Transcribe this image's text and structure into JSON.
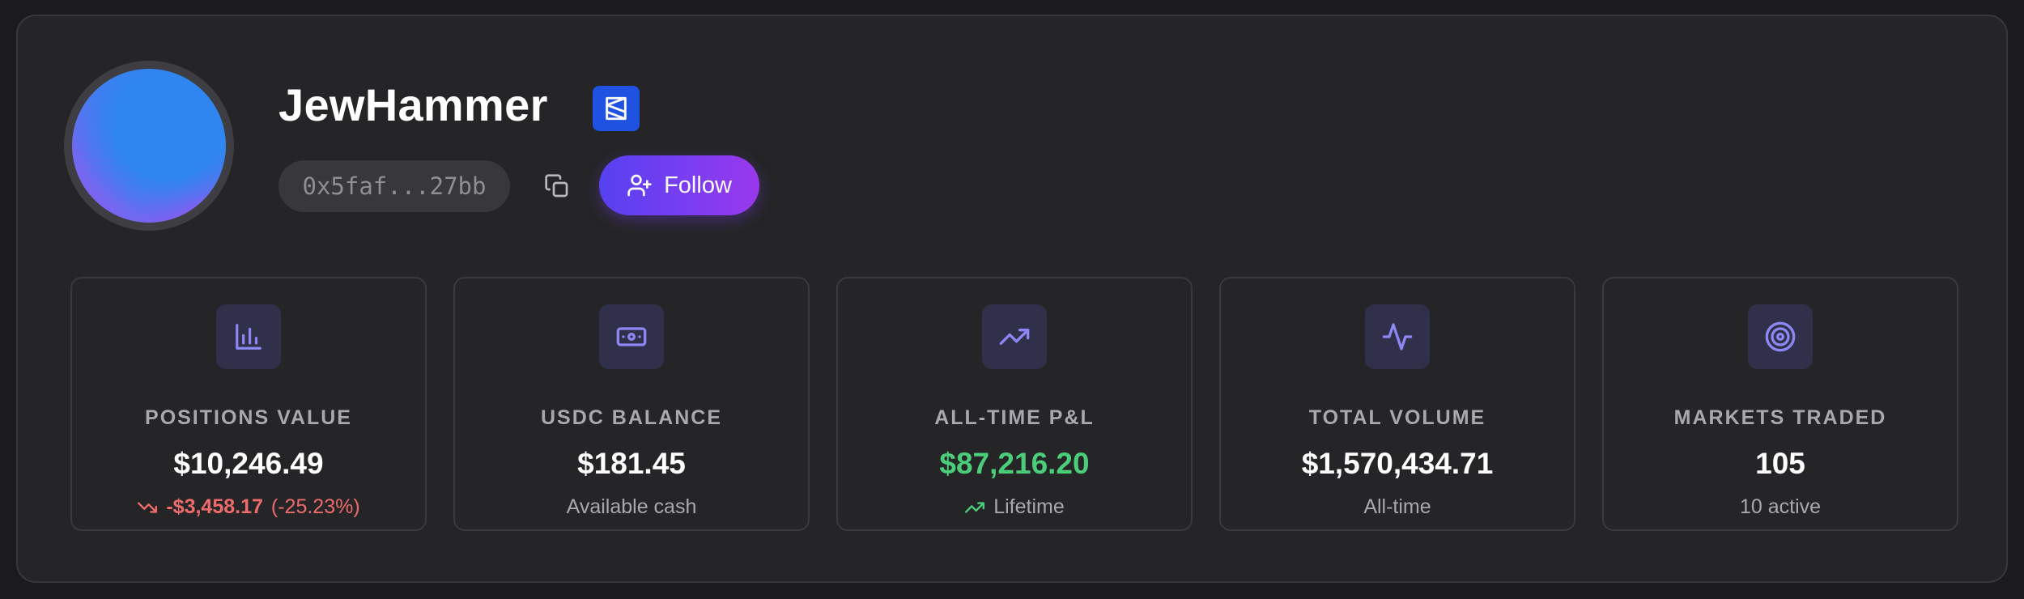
{
  "profile": {
    "username": "JewHammer",
    "address": "0x5faf...27bb",
    "follow_label": "Follow"
  },
  "icons": {
    "badge": "platform-badge-icon",
    "copy": "copy-icon",
    "follow": "user-plus-icon"
  },
  "colors": {
    "accent_start": "#5641f0",
    "accent_end": "#9a38ec",
    "positive": "#4ace7a",
    "negative": "#ee6b6b"
  },
  "stats": [
    {
      "icon": "bar-chart-icon",
      "label": "POSITIONS VALUE",
      "value": "$10,246.49",
      "change_amount": "-$3,458.17",
      "change_pct": "(-25.23%)"
    },
    {
      "icon": "banknote-icon",
      "label": "USDC BALANCE",
      "value": "$181.45",
      "sub": "Available cash"
    },
    {
      "icon": "trending-up-icon",
      "label": "ALL-TIME P&L",
      "value": "$87,216.20",
      "sub": "Lifetime"
    },
    {
      "icon": "activity-icon",
      "label": "TOTAL VOLUME",
      "value": "$1,570,434.71",
      "sub": "All-time"
    },
    {
      "icon": "target-icon",
      "label": "MARKETS TRADED",
      "value": "105",
      "sub": "10 active"
    }
  ]
}
